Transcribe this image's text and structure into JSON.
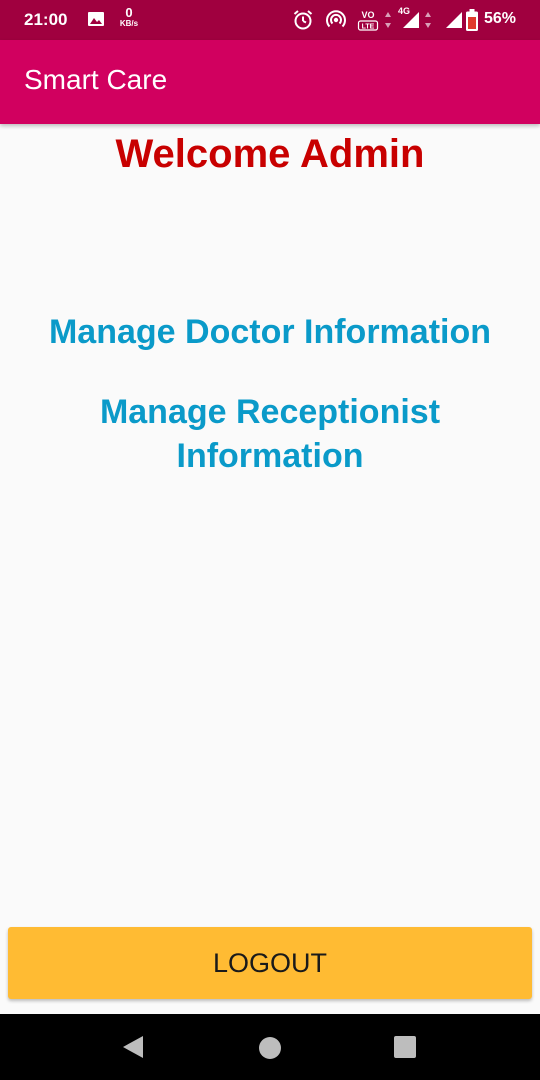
{
  "status_bar": {
    "time": "21:00",
    "net_speed_value": "0",
    "net_speed_unit": "KB/s",
    "network_type": "4G",
    "battery": "56%",
    "background_color": "#a0003f",
    "icons": [
      "gallery-icon",
      "alarm-icon",
      "hotspot-icon",
      "volte-icon",
      "signal-icon",
      "battery-icon"
    ]
  },
  "app_bar": {
    "title": "Smart Care",
    "background_color": "#d1005f"
  },
  "main": {
    "welcome": "Welcome Admin",
    "welcome_color": "#c80000",
    "links": [
      {
        "label": "Manage Doctor Information"
      },
      {
        "label": "Manage Receptionist Information"
      }
    ],
    "link_color": "#0a9ac9"
  },
  "logout": {
    "label": "LOGOUT",
    "background_color": "#ffbb33"
  },
  "nav_bar": {
    "icons": [
      "back-icon",
      "home-icon",
      "recents-icon"
    ]
  }
}
